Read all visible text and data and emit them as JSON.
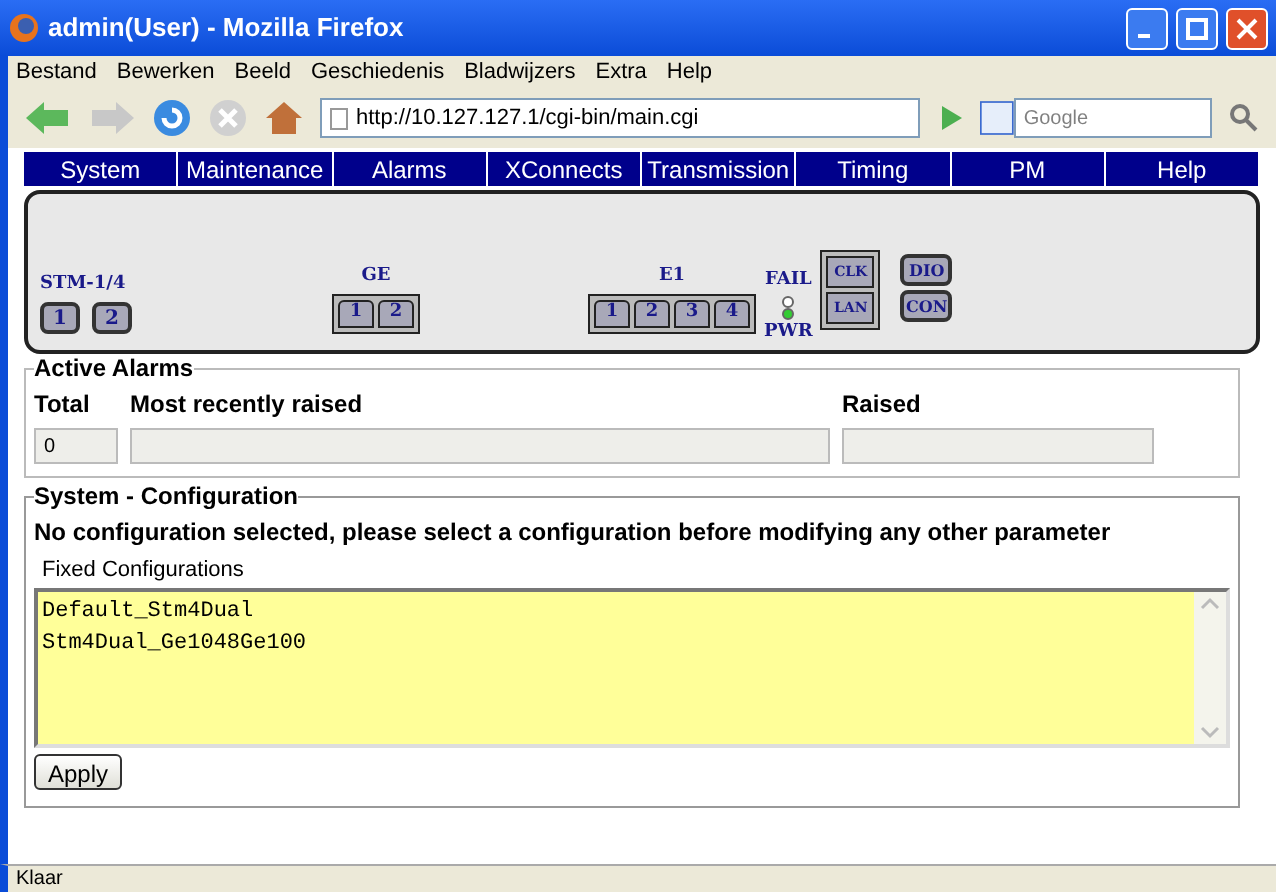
{
  "window": {
    "title": "admin(User) - Mozilla Firefox"
  },
  "menu": [
    "Bestand",
    "Bewerken",
    "Beeld",
    "Geschiedenis",
    "Bladwijzers",
    "Extra",
    "Help"
  ],
  "address": {
    "value": "http://10.127.127.1/cgi-bin/main.cgi"
  },
  "search": {
    "placeholder": "Google"
  },
  "nav_tabs": [
    "System",
    "Maintenance",
    "Alarms",
    "XConnects",
    "Transmission",
    "Timing",
    "PM",
    "Help"
  ],
  "device": {
    "stm": {
      "label": "STM-1/4",
      "ports": [
        "1",
        "2"
      ]
    },
    "ge": {
      "label": "GE",
      "ports": [
        "1",
        "2"
      ]
    },
    "e1": {
      "label": "E1",
      "ports": [
        "1",
        "2",
        "3",
        "4"
      ]
    },
    "leds": [
      {
        "label": "FAIL",
        "on": false
      },
      {
        "label": "PWR",
        "on": true
      }
    ],
    "mgmt_ports": [
      "CLK",
      "LAN"
    ],
    "aux_ports": [
      "DIO",
      "CON"
    ]
  },
  "active_alarms": {
    "title": "Active Alarms",
    "columns": [
      "Total",
      "Most recently raised",
      "Raised"
    ],
    "total": "0"
  },
  "configuration": {
    "title": "System - Configuration",
    "message": "No configuration selected, please select a configuration before modifying any other parameter",
    "list_label": "Fixed Configurations",
    "items": [
      {
        "label": "Default_Stm4Dual",
        "selected": false
      },
      {
        "label": "Stm4Dual_Ge1048Ge100",
        "selected": false
      }
    ],
    "apply": "Apply"
  },
  "status_bar": "Klaar"
}
